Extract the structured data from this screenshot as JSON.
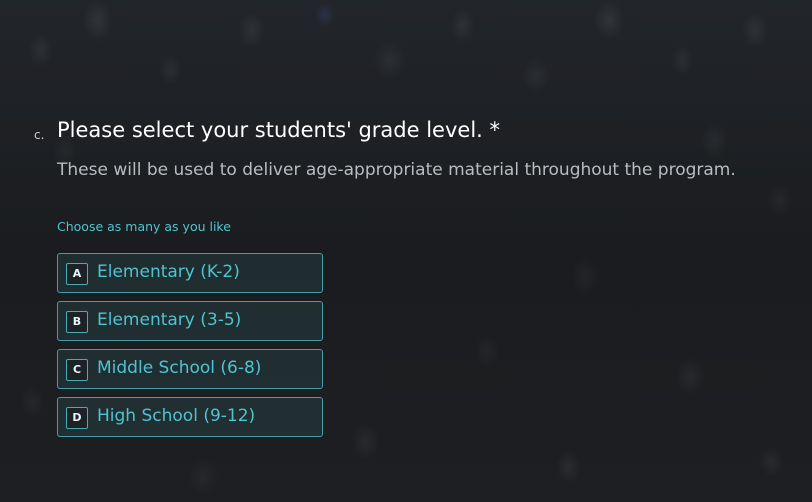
{
  "question": {
    "number": "c.",
    "title": "Please select your students' grade level. *",
    "description": "These will be used to deliver age-appropriate material throughout the program.",
    "hint": "Choose as many as you like",
    "choices": [
      {
        "key": "A",
        "label": "Elementary (K-2)"
      },
      {
        "key": "B",
        "label": "Elementary (3-5)"
      },
      {
        "key": "C",
        "label": "Middle School (6-8)"
      },
      {
        "key": "D",
        "label": "High School (9-12)"
      }
    ]
  },
  "colors": {
    "accent": "#4fc4cf",
    "title": "#ffffff",
    "description": "#b9bcc0",
    "background": "#1b1d20"
  }
}
